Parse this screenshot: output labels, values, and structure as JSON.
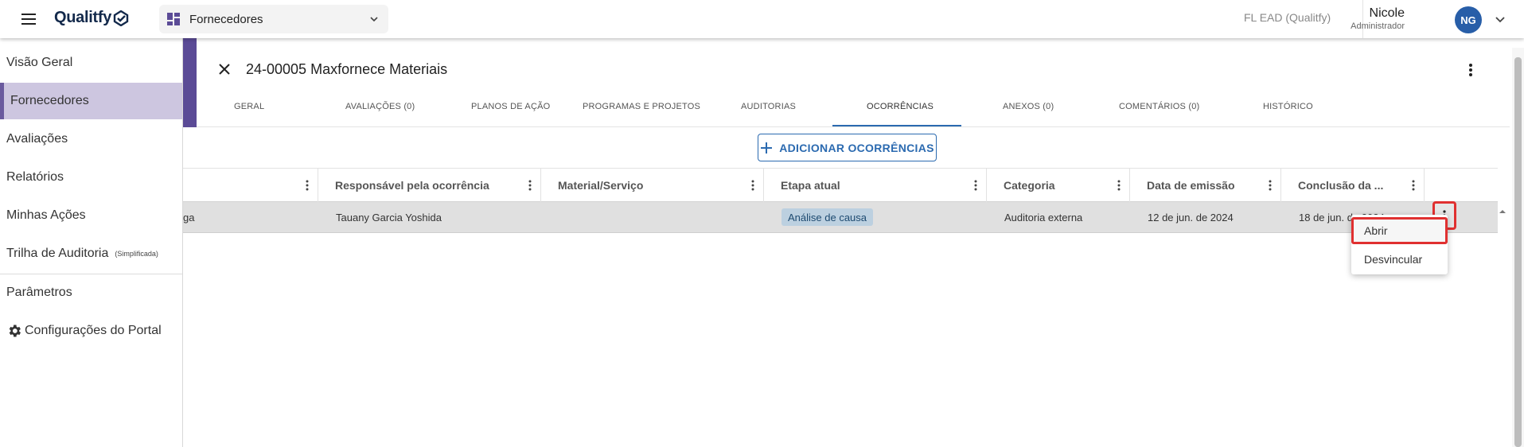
{
  "topbar": {
    "logo": "Qualitfy",
    "module": "Fornecedores",
    "company": "FL EAD (Qualitfy)",
    "user_name": "Nicole",
    "user_role": "Administrador",
    "avatar_initials": "NG"
  },
  "sidebar": {
    "items": [
      {
        "label": "Visão Geral"
      },
      {
        "label": "Fornecedores",
        "active": true
      },
      {
        "label": "Avaliações"
      },
      {
        "label": "Relatórios"
      },
      {
        "label": "Minhas Ações"
      },
      {
        "label": "Trilha de Auditoria",
        "suffix": "(Simplificada)"
      },
      {
        "label": "Parâmetros"
      },
      {
        "label": "Configurações do Portal",
        "icon": "gear-icon"
      }
    ]
  },
  "record": {
    "title": "24-00005 Maxfornece Materiais"
  },
  "tabs": [
    {
      "label": "GERAL"
    },
    {
      "label": "AVALIAÇÕES (0)"
    },
    {
      "label": "PLANOS DE AÇÃO"
    },
    {
      "label": "PROGRAMAS E PROJETOS"
    },
    {
      "label": "AUDITORIAS"
    },
    {
      "label": "OCORRÊNCIAS",
      "active": true
    },
    {
      "label": "ANEXOS (0)"
    },
    {
      "label": "COMENTÁRIOS (0)"
    },
    {
      "label": "HISTÓRICO"
    }
  ],
  "actions": {
    "add_label": "ADICIONAR OCORRÊNCIAS"
  },
  "table": {
    "columns": [
      {
        "label": ""
      },
      {
        "label": "Responsável pela ocorrência"
      },
      {
        "label": "Material/Serviço"
      },
      {
        "label": "Etapa atual"
      },
      {
        "label": "Categoria"
      },
      {
        "label": "Data de emissão"
      },
      {
        "label": "Conclusão da ..."
      }
    ],
    "rows": [
      {
        "col0": "ga",
        "responsavel": "Tauany Garcia Yoshida",
        "material": "",
        "etapa": "Análise de causa",
        "categoria": "Auditoria externa",
        "emissao": "12 de jun. de 2024",
        "conclusao": "18 de jun. de 2024"
      }
    ]
  },
  "context_menu": {
    "items": [
      {
        "label": "Abrir",
        "highlighted": true
      },
      {
        "label": "Desvincular"
      }
    ]
  },
  "colors": {
    "accent": "#5b4b96",
    "sidebar_active": "#cdc6e0",
    "primary": "#2b6ab0",
    "highlight": "#e03030",
    "avatar": "#285ea8",
    "chip": "#bcd0e0"
  }
}
